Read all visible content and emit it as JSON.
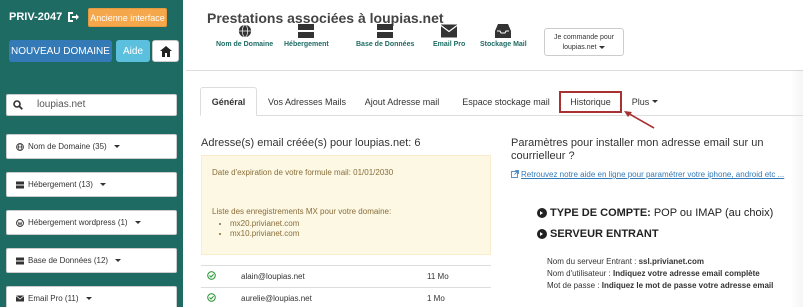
{
  "sidebar": {
    "account_id": "PRIV-2047",
    "legacy_label": "Ancienne interface",
    "new_domain_label": "NOUVEAU DOMAINE",
    "help_label": "Aide",
    "search_value": "loupias.net",
    "menu": [
      {
        "label": "Nom de Domaine (35)",
        "icon": "globe-icon"
      },
      {
        "label": "Hébergement (13)",
        "icon": "server-icon"
      },
      {
        "label": "Hébergement wordpress (1)",
        "icon": "wordpress-icon"
      },
      {
        "label": "Base de Données (12)",
        "icon": "database-icon"
      },
      {
        "label": "Email Pro (11)",
        "icon": "envelope-icon"
      }
    ]
  },
  "header": {
    "title": "Prestations associées à loupias.net",
    "nav": [
      {
        "label": "Nom de Domaine",
        "icon": "globe-icon"
      },
      {
        "label": "Hébergement",
        "icon": "server-icon"
      },
      {
        "label": "Base de Données",
        "icon": "database-icon"
      },
      {
        "label": "Email Pro",
        "icon": "envelope-icon"
      },
      {
        "label": "Stockage Mail",
        "icon": "inbox-icon"
      }
    ],
    "order_line1": "Je commande pour",
    "order_line2": "loupias.net"
  },
  "tabs": [
    {
      "label": "Général",
      "active": true
    },
    {
      "label": "Vos Adresses Mails"
    },
    {
      "label": "Ajout Adresse mail"
    },
    {
      "label": "Espace stockage mail"
    },
    {
      "label": "Historique",
      "highlighted": true
    },
    {
      "label": "Plus"
    }
  ],
  "left": {
    "heading": "Adresse(s) email créée(s) pour loupias.net: 6",
    "expiry": "Date d'expiration de votre formule mail: 01/01/2030",
    "mx_title": "Liste des enregistrements MX pour votre domaine:",
    "mx": [
      "mx20.privianet.com",
      "mx10.privianet.com"
    ],
    "emails": [
      {
        "address": "alain@loupias.net",
        "size": "11 Mo"
      },
      {
        "address": "aurelie@loupias.net",
        "size": "1 Mo"
      }
    ]
  },
  "right": {
    "heading": "Paramètres pour installer mon adresse email sur un courrielleur ?",
    "help_link": "Retrouvez notre aide en ligne pour paramétrer votre iphone, android etc ...",
    "account_type_label": "TYPE DE COMPTE:",
    "account_type_value": "POP ou IMAP (au choix)",
    "incoming_label": "SERVEUR ENTRANT",
    "server_name_label": "Nom du serveur Entrant :",
    "server_name_value": "ssl.privianet.com",
    "username_label": "Nom d'utilisateur :",
    "username_value": "Indiquez votre adresse email complète",
    "password_label": "Mot de passe :",
    "password_value": "Indiquez le mot de passe votre adresse email"
  },
  "colors": {
    "sidebar_bg": "#1e6b64",
    "primary": "#337ab7",
    "info": "#5bc0de",
    "warning": "#f5a74b",
    "highlight": "#a83232"
  }
}
